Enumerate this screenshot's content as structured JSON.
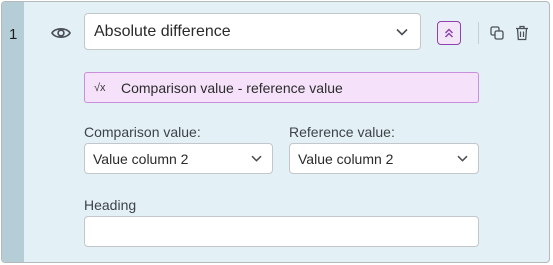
{
  "row": {
    "number": "1"
  },
  "icons": {
    "visibility": "eye-icon",
    "collapse": "chevrons-up-icon",
    "duplicate": "copy-icon",
    "delete": "trash-icon",
    "dropdown": "chevron-down-icon",
    "formula": "square-root-icon"
  },
  "calculation": {
    "type": "Absolute difference"
  },
  "formula": {
    "symbol": "√x",
    "text": "Comparison value - reference value"
  },
  "comparison": {
    "label": "Comparison value:",
    "value": "Value column 2"
  },
  "reference": {
    "label": "Reference value:",
    "value": "Value column 2"
  },
  "heading": {
    "label": "Heading",
    "value": ""
  },
  "colors": {
    "card_background": "#e3f0f6",
    "gutter": "#b4cdd6",
    "accent_purple": "#8e44ad",
    "formula_background": "#f5e2fa"
  }
}
